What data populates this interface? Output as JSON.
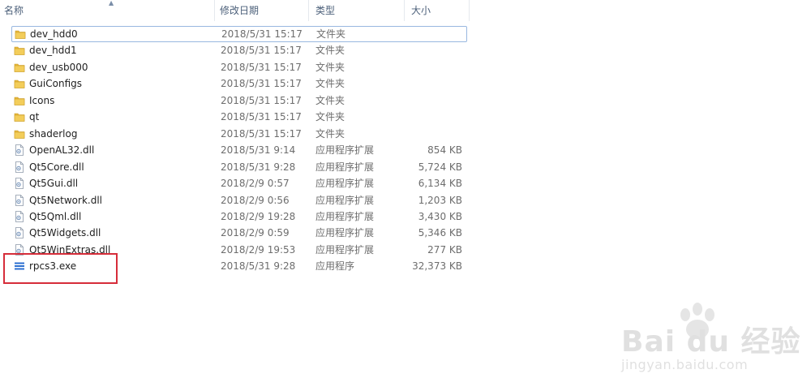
{
  "header": {
    "name": "名称",
    "date": "修改日期",
    "type": "类型",
    "size": "大小"
  },
  "files": [
    {
      "name": "dev_hdd0",
      "date": "2018/5/31 15:17",
      "type": "文件夹",
      "size": "",
      "icon": "folder-icon"
    },
    {
      "name": "dev_hdd1",
      "date": "2018/5/31 15:17",
      "type": "文件夹",
      "size": "",
      "icon": "folder-icon"
    },
    {
      "name": "dev_usb000",
      "date": "2018/5/31 15:17",
      "type": "文件夹",
      "size": "",
      "icon": "folder-icon"
    },
    {
      "name": "GuiConfigs",
      "date": "2018/5/31 15:17",
      "type": "文件夹",
      "size": "",
      "icon": "folder-icon"
    },
    {
      "name": "Icons",
      "date": "2018/5/31 15:17",
      "type": "文件夹",
      "size": "",
      "icon": "folder-icon"
    },
    {
      "name": "qt",
      "date": "2018/5/31 15:17",
      "type": "文件夹",
      "size": "",
      "icon": "folder-icon"
    },
    {
      "name": "shaderlog",
      "date": "2018/5/31 15:17",
      "type": "文件夹",
      "size": "",
      "icon": "folder-icon"
    },
    {
      "name": "OpenAL32.dll",
      "date": "2018/5/31 9:14",
      "type": "应用程序扩展",
      "size": "854 KB",
      "icon": "dll-file-icon"
    },
    {
      "name": "Qt5Core.dll",
      "date": "2018/5/31 9:28",
      "type": "应用程序扩展",
      "size": "5,724 KB",
      "icon": "dll-file-icon"
    },
    {
      "name": "Qt5Gui.dll",
      "date": "2018/2/9 0:57",
      "type": "应用程序扩展",
      "size": "6,134 KB",
      "icon": "dll-file-icon"
    },
    {
      "name": "Qt5Network.dll",
      "date": "2018/2/9 0:56",
      "type": "应用程序扩展",
      "size": "1,203 KB",
      "icon": "dll-file-icon"
    },
    {
      "name": "Qt5Qml.dll",
      "date": "2018/2/9 19:28",
      "type": "应用程序扩展",
      "size": "3,430 KB",
      "icon": "dll-file-icon"
    },
    {
      "name": "Qt5Widgets.dll",
      "date": "2018/2/9 0:59",
      "type": "应用程序扩展",
      "size": "5,346 KB",
      "icon": "dll-file-icon"
    },
    {
      "name": "Qt5WinExtras.dll",
      "date": "2018/2/9 19:53",
      "type": "应用程序扩展",
      "size": "277 KB",
      "icon": "dll-file-icon"
    },
    {
      "name": "rpcs3.exe",
      "date": "2018/5/31 9:28",
      "type": "应用程序",
      "size": "32,373 KB",
      "icon": "exe-file-icon"
    }
  ],
  "watermark": {
    "brand": "Bai du 经验",
    "url": "jingyan.baidu.com"
  },
  "colors": {
    "folder": "#e8b93c",
    "highlight": "#d62d3a",
    "exe_icon": "#2c6fd0"
  }
}
